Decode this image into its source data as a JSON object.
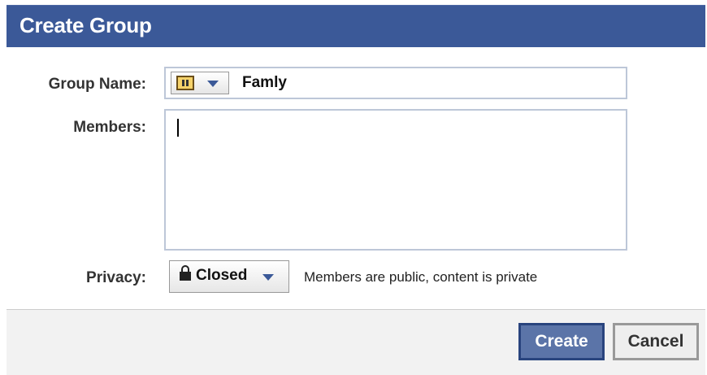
{
  "dialog": {
    "title": "Create Group"
  },
  "form": {
    "group_name_label": "Group Name:",
    "group_name_value": "Famly",
    "members_label": "Members:",
    "members_value": "",
    "privacy_label": "Privacy:",
    "privacy_value": "Closed",
    "privacy_description": "Members are public, content is private"
  },
  "buttons": {
    "create_label": "Create",
    "cancel_label": "Cancel"
  },
  "icons": {
    "group_icon": "group-icon",
    "lock_icon": "lock-icon",
    "dropdown_icon": "chevron-down-icon"
  },
  "colors": {
    "title_bar": "#3b5998",
    "primary_button": "#5b74a8",
    "input_border": "#bdc7d8"
  }
}
